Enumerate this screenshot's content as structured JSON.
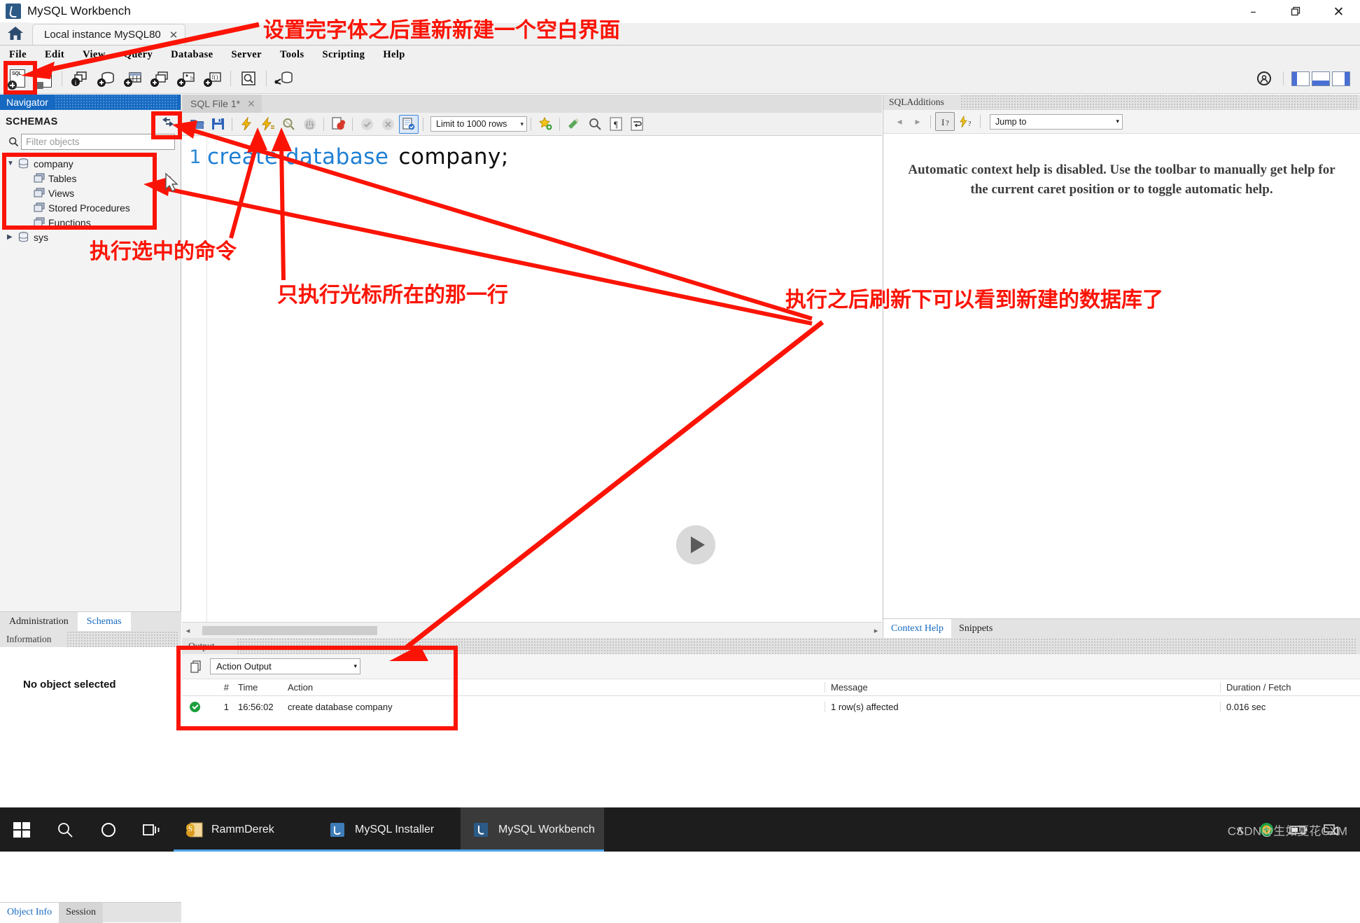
{
  "window": {
    "title": "MySQL Workbench",
    "icon": "mysql-dolphin-icon",
    "controls": {
      "minimize": "–",
      "restore": "❐",
      "close": "✕"
    }
  },
  "tabs": {
    "home_icon": "home-icon",
    "connection_tab": "Local instance MySQL80",
    "close_glyph": "✕"
  },
  "menubar": {
    "items": [
      "File",
      "Edit",
      "View",
      "Query",
      "Database",
      "Server",
      "Tools",
      "Scripting",
      "Help"
    ]
  },
  "main_toolbar": {
    "icons": [
      "new-sql-tab-icon",
      "open-sql-script-icon",
      "connection-info-icon",
      "create-schema-icon",
      "create-table-icon",
      "create-view-icon",
      "create-procedure-icon",
      "create-function-icon",
      "search-data-icon",
      "reconnect-server-icon"
    ],
    "right_icons": [
      "admin-target-icon",
      "layout-sidebar-icon",
      "layout-output-icon",
      "layout-secondary-sidebar-icon"
    ]
  },
  "navigator": {
    "title": "Navigator",
    "section_label": "SCHEMAS",
    "refresh_icon": "refresh-icon",
    "search_icon": "search-icon",
    "filter_placeholder": "Filter objects",
    "filter_value": "",
    "tree": [
      {
        "label": "company",
        "expanded": true,
        "icon": "database-icon",
        "children": [
          {
            "label": "Tables",
            "icon": "folder-icon"
          },
          {
            "label": "Views",
            "icon": "folder-icon"
          },
          {
            "label": "Stored Procedures",
            "icon": "folder-icon"
          },
          {
            "label": "Functions",
            "icon": "folder-icon"
          }
        ]
      },
      {
        "label": "sys",
        "expanded": false,
        "icon": "database-icon",
        "children": []
      }
    ],
    "bottom_tabs": [
      {
        "label": "Administration",
        "active": false
      },
      {
        "label": "Schemas",
        "active": true
      }
    ],
    "information": {
      "title": "Information",
      "body": "No object selected"
    },
    "object_tabs": [
      {
        "label": "Object Info",
        "active": true
      },
      {
        "label": "Session",
        "active": false
      }
    ]
  },
  "editor": {
    "tab_label": "SQL File 1*",
    "tab_close": "✕",
    "toolbar_icons": [
      "open-file-icon",
      "save-file-icon",
      "execute-all-icon",
      "execute-current-line-icon",
      "explain-query-icon",
      "stop-query-icon",
      "toggle-stop-on-error-icon",
      "commit-icon",
      "rollback-icon",
      "toggle-autocommit-icon",
      "beautify-sql-icon",
      "find-icon",
      "toggle-invisible-chars-icon",
      "wrap-lines-icon"
    ],
    "limit_label": "Limit to 1000 rows",
    "limit_caret": "▾",
    "code": {
      "line_number": "1",
      "keyword": "create database",
      "identifier": "company;"
    },
    "play_overlay_icon": "play-icon",
    "hscroll": {
      "left_arrow": "◂",
      "right_arrow": "▸"
    }
  },
  "sql_additions": {
    "title": "SQLAdditions",
    "nav_back": "◂",
    "nav_forward": "▸",
    "icons": [
      "context-help-icon",
      "auto-context-help-icon"
    ],
    "jump_to_label": "Jump to",
    "jump_to_caret": "▾",
    "message": "Automatic context help is disabled. Use the toolbar to manually get help for the current caret position or to toggle automatic help.",
    "tabs": [
      {
        "label": "Context Help",
        "active": true
      },
      {
        "label": "Snippets",
        "active": false
      }
    ]
  },
  "output": {
    "title": "Output",
    "copy_icon": "copy-icon",
    "selector_value": "Action Output",
    "selector_caret": "▾",
    "columns": [
      "",
      "#",
      "Time",
      "Action",
      "Message",
      "Duration / Fetch"
    ],
    "rows": [
      {
        "status": "success",
        "num": "1",
        "time": "16:56:02",
        "action": "create database company",
        "message": "1 row(s) affected",
        "duration": "0.016 sec"
      }
    ]
  },
  "taskbar": {
    "start_icon": "windows-start-icon",
    "search_icon": "search-icon",
    "cortana_icon": "cortana-circle-icon",
    "taskview_icon": "task-view-icon",
    "apps": [
      {
        "label": "RammDerek",
        "icon": "rammderek-icon",
        "active": false,
        "running": true
      },
      {
        "label": "MySQL Installer",
        "icon": "mysql-installer-icon",
        "active": false,
        "running": true
      },
      {
        "label": "MySQL Workbench",
        "icon": "mysql-workbench-icon",
        "active": true,
        "running": true
      }
    ],
    "tray": {
      "chevron": "∧",
      "icons": [
        "update-icon",
        "battery-icon",
        "network-icon"
      ],
      "watermark": "CSDN@生如夏花CXM"
    }
  },
  "annotations": {
    "accent_color": "#fb1405",
    "notes": [
      {
        "id": "note-new-blank-editor",
        "text": "设置完字体之后重新新建一个空白界面"
      },
      {
        "id": "note-execute-selection",
        "text": "执行选中的命令"
      },
      {
        "id": "note-execute-current-line",
        "text": "只执行光标所在的那一行"
      },
      {
        "id": "note-refresh-to-see-db",
        "text": "执行之后刷新下可以看到新建的数据库了"
      }
    ],
    "highlight_boxes": [
      "new-sql-tab-button-box",
      "refresh-schemas-button-box",
      "company-schema-tree-box",
      "output-result-row-box"
    ]
  }
}
